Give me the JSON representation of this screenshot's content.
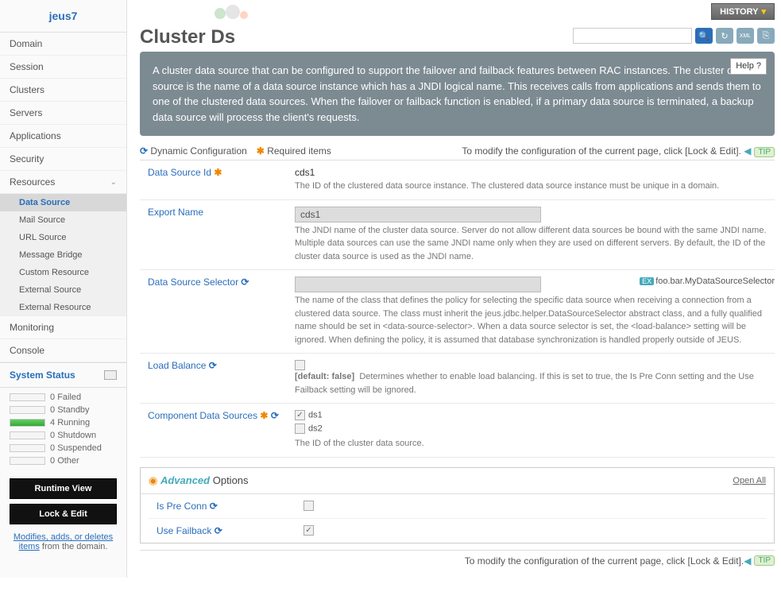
{
  "app": {
    "logo": "jeus7"
  },
  "sidebar": {
    "items": [
      "Domain",
      "Session",
      "Clusters",
      "Servers",
      "Applications",
      "Security",
      "Resources"
    ],
    "resources_sub": [
      "Data Source",
      "Mail Source",
      "URL Source",
      "Message Bridge",
      "Custom Resource",
      "External Source",
      "External Resource"
    ],
    "monitoring": "Monitoring",
    "console": "Console",
    "system_status_title": "System Status",
    "status": [
      {
        "count": "0",
        "label": "Failed"
      },
      {
        "count": "0",
        "label": "Standby"
      },
      {
        "count": "4",
        "label": "Running"
      },
      {
        "count": "0",
        "label": "Shutdown"
      },
      {
        "count": "0",
        "label": "Suspended"
      },
      {
        "count": "0",
        "label": "Other"
      }
    ],
    "runtime_btn": "Runtime View",
    "lock_btn": "Lock & Edit",
    "note_underline": "Modifies, adds, or deletes items",
    "note_rest": " from the domain."
  },
  "header": {
    "history": "HISTORY",
    "title": "Cluster Ds",
    "help": "Help"
  },
  "info": "A cluster data source that can be configured to support the failover and failback features between RAC instances. The cluster data source is the name of a data source instance which has a JNDI logical name. This receives calls from applications and sends them to one of the clustered data sources. When the failover or failback function is enabled, if a primary data source is terminated, a backup data source will process the client's requests.",
  "legend": {
    "dyn": "Dynamic Configuration",
    "req": "Required items",
    "modify": "To modify the configuration of the current page, click [Lock & Edit].",
    "tip": "TIP"
  },
  "fields": {
    "ds_id": {
      "label": "Data Source Id",
      "value": "cds1",
      "desc": "The ID of the clustered data source instance. The clustered data source instance must be unique in a domain."
    },
    "export": {
      "label": "Export Name",
      "value": "cds1",
      "desc": "The JNDI name of the cluster data source. Server do not allow different data sources be bound with the same JNDI name. Multiple data sources can use the same JNDI name only when they are used on different servers. By default, the ID of the cluster data source is used as the JNDI name."
    },
    "selector": {
      "label": "Data Source Selector",
      "ex": "foo.bar.MyDataSourceSelector",
      "desc": "The name of the class that defines the policy for selecting the specific data source when receiving a connection from a clustered data source. The class must inherit the jeus.jdbc.helper.DataSourceSelector abstract class, and a fully qualified name should be set in <data-source-selector>. When a data source selector is set, the <load-balance> setting will be ignored. When defining the policy, it is assumed that database synchronization is handled properly outside of JEUS."
    },
    "load": {
      "label": "Load Balance",
      "default": "[default: false]",
      "desc": "Determines whether to enable load balancing. If this is set to true, the Is Pre Conn setting and the Use Failback setting will be ignored."
    },
    "comp": {
      "label": "Component Data Sources",
      "ds1": "ds1",
      "ds2": "ds2",
      "desc": "The ID of the cluster data source."
    }
  },
  "advanced": {
    "title_hl": "Advanced",
    "title_rest": " Options",
    "open_all": "Open All",
    "preconn": "Is Pre Conn",
    "failback": "Use Failback"
  }
}
